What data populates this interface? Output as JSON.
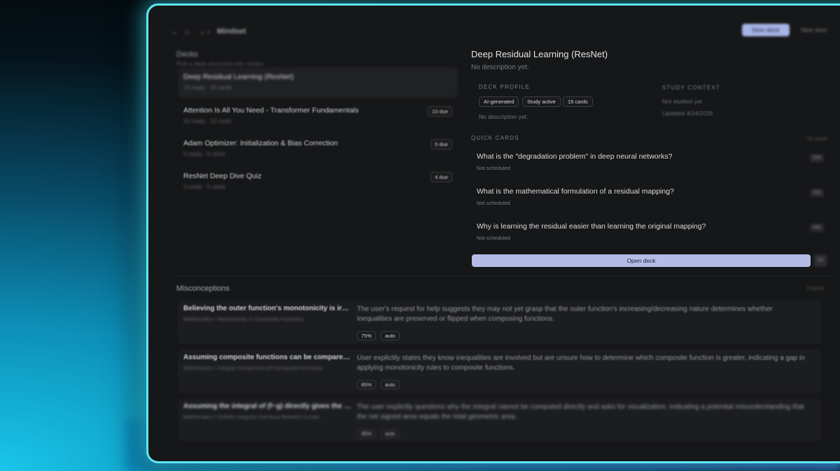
{
  "app": {
    "title": "Mindset"
  },
  "topbar": {
    "primary_label": "New deck",
    "right_label": "New item"
  },
  "decks": {
    "heading": "Decks",
    "subtitle": "Pick a deck and jump into review.",
    "items": [
      {
        "title": "Deep Residual Learning (ResNet)",
        "meta": "15 ready · 15 cards",
        "due": ""
      },
      {
        "title": "Attention Is All You Need - Transformer Fundamentals",
        "meta": "10 ready · 12 cards",
        "due": "10 due"
      },
      {
        "title": "Adam Optimizer: Initialization & Bias Correction",
        "meta": "5 ready · 6 cards",
        "due": "5 due"
      },
      {
        "title": "ResNet Deep Dive Quiz",
        "meta": "4 ready · 5 cards",
        "due": "4 due"
      }
    ]
  },
  "detail": {
    "title": "Deep Residual Learning (ResNet)",
    "description": "No description yet.",
    "profile_label": "DECK PROFILE",
    "chips": [
      "AI-generated",
      "Study active",
      "15 cards"
    ],
    "profile_description": "No description yet.",
    "context_label": "STUDY CONTEXT",
    "context_line1": "Not studied yet",
    "context_line2": "Updated 4/24/2026",
    "quick_cards_label": "QUICK CARDS",
    "quick_cards_count": "15 cards",
    "quick_cards": [
      {
        "question": "What is the \"degradation problem\" in deep neural networks?",
        "schedule": "Not scheduled",
        "action": "Edit"
      },
      {
        "question": "What is the mathematical formulation of a residual mapping?",
        "schedule": "Not scheduled",
        "action": "Edit"
      },
      {
        "question": "Why is learning the residual easier than learning the original mapping?",
        "schedule": "Not scheduled",
        "action": "Edit"
      }
    ],
    "open_deck_label": "Open deck",
    "open_side_label": "Go"
  },
  "misconceptions": {
    "heading": "Misconceptions",
    "count": "3 items",
    "items": [
      {
        "title": "Believing the outer function's monotonicity is irrel...",
        "path": "Mathematics / Monotonicity In Composite Functions",
        "description": "The user's request for help suggests they may not yet grasp that the outer function's increasing/decreasing nature determines whether inequalities are preserved or flipped when composing functions.",
        "confidence": "75%",
        "source": "auto"
      },
      {
        "title": "Assuming composite functions can be compared ...",
        "path": "Mathematics / Integral Comparison Of Composite Functions",
        "description": "User explicitly states they know inequalities are involved but are unsure how to determine which composite function is greater, indicating a gap in applying monotonicity rules to composite functions.",
        "confidence": "85%",
        "source": "auto"
      },
      {
        "title": "Assuming the integral of (f−g) directly gives the t...",
        "path": "Mathematics / Definite Integrals And Area Between Curves",
        "description": "The user explicitly questions why the integral cannot be computed directly and asks for visualization, indicating a potential misunderstanding that the net signed area equals the total geometric area.",
        "confidence": "95%",
        "source": "auto"
      }
    ]
  }
}
